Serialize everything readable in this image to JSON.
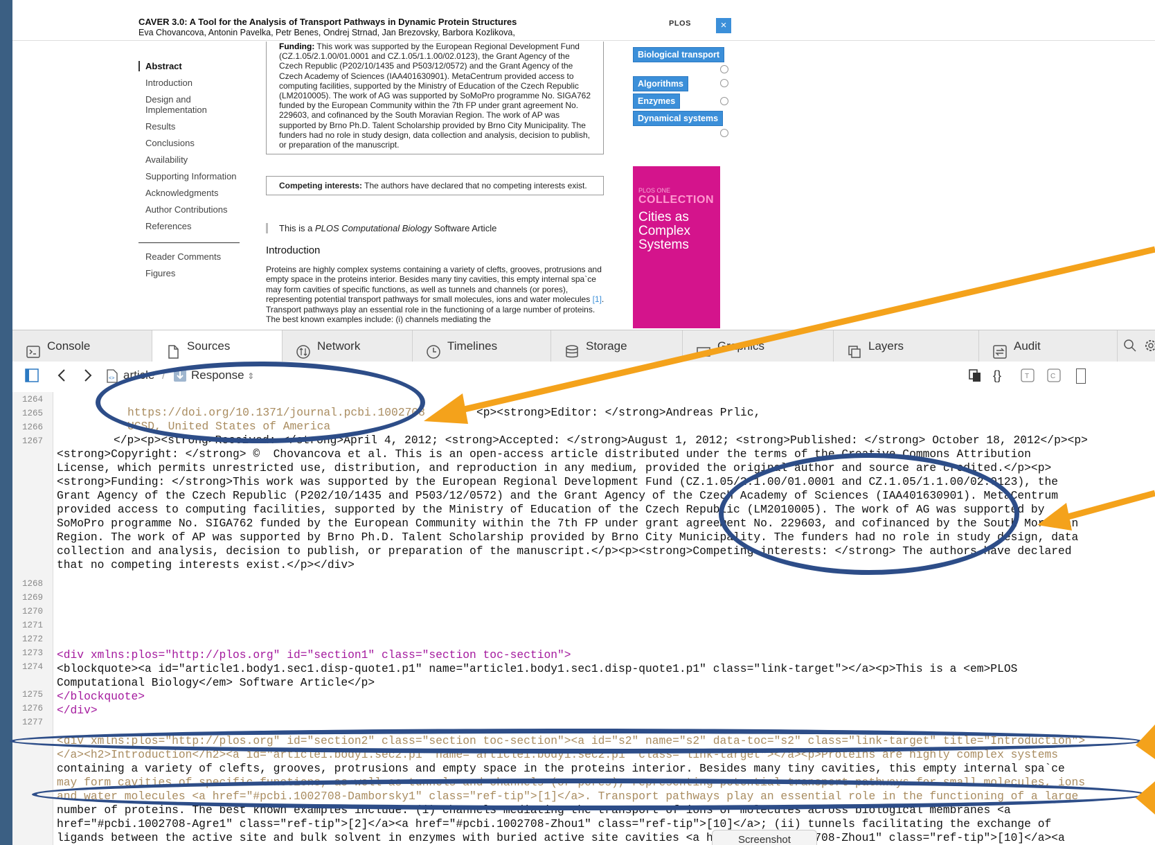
{
  "article": {
    "title": "CAVER 3.0: A Tool for the Analysis of Transport Pathways in Dynamic Protein Structures",
    "authors": "Eva Chovancova,  Antonin Pavelka,  Petr Benes,  Ondrej Strnad,  Jan Brezovsky,  Barbora Kozlikova,",
    "logo": "PLOS",
    "close": "×"
  },
  "toc": [
    "Abstract",
    "Introduction",
    "Design and Implementation",
    "Results",
    "Conclusions",
    "Availability",
    "Supporting Information",
    "Acknowledgments",
    "Author Contributions",
    "References"
  ],
  "toc_secondary": [
    "Reader Comments",
    "Figures"
  ],
  "funding": {
    "label": "Funding:",
    "text": " This work was supported by the European Regional Development Fund (CZ.1.05/2.1.00/01.0001 and CZ.1.05/1.1.00/02.0123), the Grant Agency of the Czech Republic (P202/10/1435 and P503/12/0572) and the Grant Agency of the Czech Academy of Sciences (IAA401630901). MetaCentrum provided access to computing facilities, supported by the Ministry of Education of the Czech Republic (LM2010005). The work of AG was supported by SoMoPro programme No. SIGA762 funded by the European Community within the 7th FP under grant agreement No. 229603, and cofinanced by the South Moravian Region. The work of AP was supported by Brno Ph.D. Talent Scholarship provided by Brno City Municipality. The funders had no role in study design, data collection and analysis, decision to publish, or preparation of the manuscript."
  },
  "competing": {
    "label": "Competing interests:",
    "text": " The authors have declared that no competing interests exist."
  },
  "quote_note": {
    "pre": "This is a ",
    "em": "PLOS Computational Biology",
    "post": " Software Article"
  },
  "intro": {
    "heading": "Introduction",
    "text": "Proteins are highly complex systems containing a variety of clefts, grooves, protrusions and empty space in the proteins interior. Besides many tiny cavities, this empty internal spa`ce may form cavities of specific functions, as well as tunnels and channels (or pores), representing potential transport pathways for small molecules, ions and water molecules ",
    "ref": "[1]",
    "text2": ". Transport pathways play an essential role in the functioning of a large number of proteins. The best known examples include: (i) channels mediating the"
  },
  "tags": [
    "Biological transport",
    "Algorithms",
    "Enzymes",
    "Dynamical systems"
  ],
  "promo": {
    "small": "PLOS ONE",
    "collection": "COLLECTION",
    "title": "Cities as Complex Systems"
  },
  "devtools": {
    "tabs": [
      "Console",
      "Sources",
      "Network",
      "Timelines",
      "Storage",
      "Graphics",
      "Layers",
      "Audit"
    ],
    "active_tab": "Sources"
  },
  "sources_bar": {
    "crumb": "article",
    "separator": "/",
    "response": "Response"
  },
  "line_numbers": [
    "1264",
    "1265",
    "1266",
    "1267",
    "1268",
    "1269",
    "1270",
    "1271",
    "1272",
    "1273",
    "1274",
    "1275",
    "1276",
    "1277"
  ],
  "code": {
    "l1265": "https://doi.org/10.1371/journal.pcbi.1002708",
    "l1265b": "<p><strong>Editor: </strong>Andreas Prlic,",
    "l1266": "UCSD, United States of America",
    "l1267a": "</p><p><strong>Received: </strong>April 4, 2012; <strong>Accepted: </strong>August 1, 2012; <strong>Published: </strong> October 18, 2012</p><p>",
    "l1267b": "<strong>Copyright: </strong> ©  Chovancova et al. This is an open-access article distributed under the terms of the Creative Commons Attribution",
    "l1267c": "License, which permits unrestricted use, distribution, and reproduction in any medium, provided the original author and source are credited.</p><p>",
    "l1267d": "<strong>Funding: </strong>This work was supported by the European Regional Development Fund (CZ.1.05/2.1.00/01.0001 and CZ.1.05/1.1.00/02.0123), the",
    "l1267e": "Grant Agency of the Czech Republic (P202/10/1435 and P503/12/0572) and the Grant Agency of the Czech Academy of Sciences (IAA401630901). MetaCentrum",
    "l1267f": "provided access to computing facilities, supported by the Ministry of Education of the Czech Republic (LM2010005). The work of AG was supported by",
    "l1267g": "SoMoPro programme No. SIGA762 funded by the European Community within the 7th FP under grant agreement No. 229603, and cofinanced by the South Moravian",
    "l1267h": "Region. The work of AP was supported by Brno Ph.D. Talent Scholarship provided by Brno City Municipality. The funders had no role in study design, data",
    "l1267i": "collection and analysis, decision to publish, or preparation of the manuscript.</p><p><strong>Competing interests: </strong> The authors have declared",
    "l1267j": "that no competing interests exist.</p></div>",
    "l1273": "<div xmlns:plos=\"http://plos.org\" id=\"section1\" class=\"section toc-section\">",
    "l1274a": "<blockquote><a id=\"article1.body1.sec1.disp-quote1.p1\" name=\"article1.body1.sec1.disp-quote1.p1\" class=\"link-target\"></a><p>This is a <em>PLOS",
    "l1274b": "Computational Biology</em> Software Article</p>",
    "l1275": "</blockquote>",
    "l1276": "</div>",
    "l1278a": "<div xmlns:plos=\"http://plos.org\" id=\"section2\" class=\"section toc-section\"><a id=\"s2\" name=\"s2\" data-toc=\"s2\" class=\"link-target\" title=\"Introduction\">",
    "l1278b": "</a><h2>Introduction</h2><a id=\"article1.body1.sec2.p1\" name=\"article1.body1.sec2.p1\" class=\"link-target\"></a><p>Proteins are highly complex systems",
    "l1278c": "containing a variety of clefts, grooves, protrusions and empty space in the proteins interior. Besides many tiny cavities, this empty internal spa`ce",
    "l1278d": "may form cavities of specific functions, as well as tunnels and channels (or pores), representing potential transport pathways for small molecules, ions",
    "l1278e": "and water molecules <a href=\"#pcbi.1002708-Damborsky1\" class=\"ref-tip\">[1]</a>. Transport pathways play an essential role in the functioning of a large",
    "l1278f": "number of proteins. The best known examples include: (i) channels mediating the transport of ions or molecules across biological membranes <a",
    "l1278g": "href=\"#pcbi.1002708-Agre1\" class=\"ref-tip\">[2]</a><a href=\"#pcbi.1002708-Zhou1\" class=\"ref-tip\">[10]</a>; (ii) tunnels facilitating the exchange of",
    "l1278h": "ligands between the active site and bulk solvent in enzymes with buried active site cavities <a href=\"#pcbi.1002708-Zhou1\" class=\"ref-tip\">[10]</a><a"
  },
  "tooltip": "Screenshot",
  "colors": {
    "accent": "#3b8fd9",
    "ellipse": "#2d4d88",
    "arrow": "#f4a21b",
    "promo": "#d4148c"
  }
}
